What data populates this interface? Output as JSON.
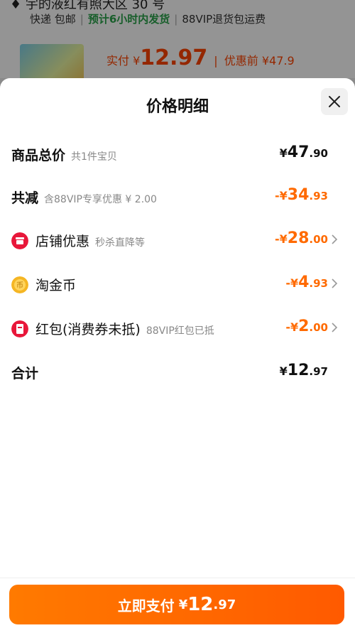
{
  "background": {
    "top_text": "♦ 宇的液红有照大区 30 号",
    "shipping": [
      "快递 包邮",
      "预计6小时内发货",
      "88VIP退货包运费"
    ],
    "price_label": "实付",
    "price_yen": "¥",
    "price_value": "12.97",
    "pre_price": "优惠前 ¥47.9"
  },
  "sheet": {
    "title": "价格明细",
    "rows": [
      {
        "label": "商品总价",
        "sub": "共1件宝贝",
        "amount_prefix": "¥",
        "amount_int": "47",
        "amount_dec": ".90"
      },
      {
        "label": "共减",
        "sub": "含88VIP专享优惠 ¥ 2.00",
        "amount_prefix": "-¥",
        "amount_int": "34",
        "amount_dec": ".93"
      },
      {
        "label": "店铺优惠",
        "sub": "秒杀直降等",
        "amount_prefix": "-¥",
        "amount_int": "28",
        "amount_dec": ".00"
      },
      {
        "label": "淘金币",
        "sub": "",
        "amount_prefix": "-¥",
        "amount_int": "4",
        "amount_dec": ".93"
      },
      {
        "label": "红包(消费券未抵)",
        "sub": "88VIP红包已抵",
        "amount_prefix": "-¥",
        "amount_int": "2",
        "amount_dec": ".00"
      },
      {
        "label": "合计",
        "sub": "",
        "amount_prefix": "¥",
        "amount_int": "12",
        "amount_dec": ".97"
      }
    ]
  },
  "pay_button": {
    "label": "立即支付",
    "yen": "¥",
    "int": "12",
    "dec": ".97"
  },
  "icons": {
    "store": "store-discount-icon",
    "coin": "taojinbi-coin-icon",
    "redpacket": "red-packet-icon",
    "close": "close-icon",
    "chevron": "chevron-right-icon"
  },
  "colors": {
    "accent": "#ff6a00",
    "text": "#111111",
    "sub": "#888888"
  }
}
